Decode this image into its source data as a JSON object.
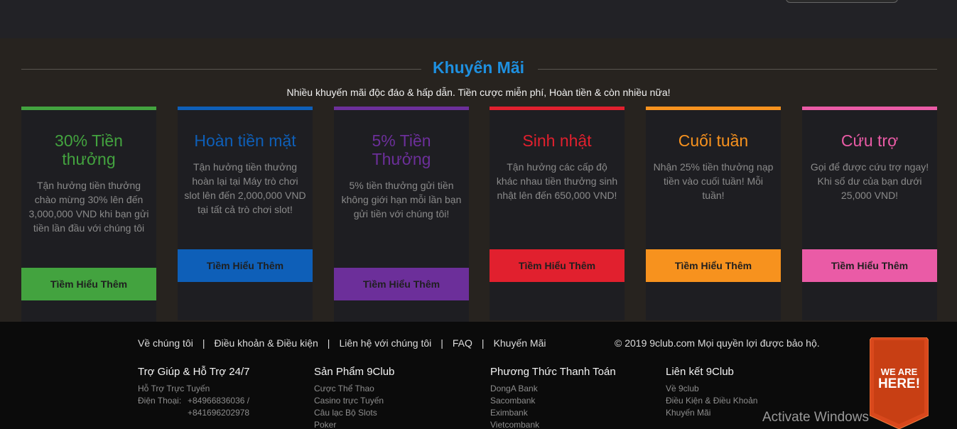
{
  "promo": {
    "title": "Khuyến Mãi",
    "subtitle": "Nhiều khuyến mãi độc đáo & hấp dẫn. Tiền cược miễn phí, Hoàn tiền & còn nhiều nữa!",
    "cards": [
      {
        "title": "30% Tiền thưởng",
        "desc": "Tận hưởng tiền thưởng chào mừng 30% lên đến 3,000,000 VND khi bạn gửi tiền lần đầu với chúng tôi",
        "button": "Tìềm Hiểu Thêm",
        "color": "#43a33f"
      },
      {
        "title": "Hoàn tiền mặt",
        "desc": "Tận hưởng tiền thưởng hoàn lại tại Máy trò chơi slot lên đến 2,000,000 VND tại tất cả trò chơi slot!",
        "button": "Tìềm Hiểu Thêm",
        "color": "#0e5fb8"
      },
      {
        "title": "5% Tiền Thưởng",
        "desc": "5% tiền thưởng gửi tiền không giới hạn mỗi lần bạn gửi tiền với chúng tôi!",
        "button": "Tìềm Hiểu Thêm",
        "color": "#6c2f9a"
      },
      {
        "title": "Sinh nhật",
        "desc": "Tận hưởng các cấp độ khác nhau tiền thưởng sinh nhật lên đến 650,000 VND!",
        "button": "Tìềm Hiểu Thêm",
        "color": "#e1202e"
      },
      {
        "title": "Cuối tuần",
        "desc": "Nhận 25% tiền thưởng nạp tiền vào cuối tuần! Mỗi tuần!",
        "button": "Tìềm Hiểu Thêm",
        "color": "#f7921e"
      },
      {
        "title": "Cứu trợ",
        "desc": "Gọi để được cứu trợ ngay! Khi số dư của bạn dưới 25,000 VND!",
        "button": "Tìềm Hiểu Thêm",
        "color": "#ea5ba6"
      }
    ]
  },
  "footer": {
    "links": [
      "Về chúng tôi",
      "Điều khoản & Điều kiện",
      "Liên hệ với chúng tôi",
      "FAQ",
      "Khuyến Mãi"
    ],
    "separator": "|",
    "copyright": "© 2019 9club.com Mọi quyền lợi được bảo hộ.",
    "support": {
      "title": "Trợ Giúp & Hỗ Trợ 24/7",
      "online": "Hỗ Trợ Trực Tuyến",
      "phone_label": "Điện Thoại:",
      "phone1": "+84966836036 /",
      "phone2": "+841696202978"
    },
    "products": {
      "title": "Sản Phẩm 9Club",
      "items": [
        "Cược Thể Thao",
        "Casino trực Tuyến",
        "Câu lạc Bộ Slots",
        "Poker"
      ]
    },
    "payment": {
      "title": "Phương Thức Thanh Toán",
      "items": [
        "DongA Bank",
        "Sacombank",
        "Eximbank",
        "Vietcombank"
      ]
    },
    "links9club": {
      "title": "Liên kết 9Club",
      "items": [
        "Về 9club",
        "Điều Kiện & Điều Khoản",
        "Khuyến Mãi"
      ]
    }
  },
  "ribbon": {
    "line1": "WE ARE",
    "line2": "HERE!",
    "color": "#d9481c"
  },
  "watermark": "Activate Windows"
}
